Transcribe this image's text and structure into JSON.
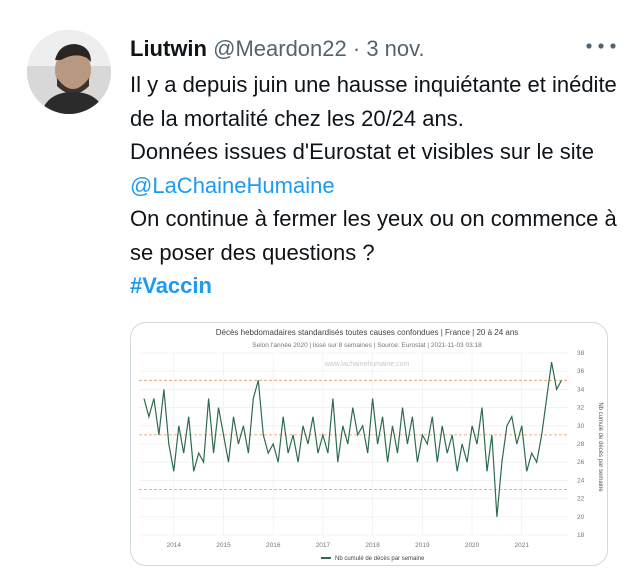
{
  "tweet": {
    "author_name": "Liutwin",
    "author_handle": "@Meardon22",
    "separator": " · ",
    "date": "3 nov.",
    "line1": "Il y a depuis juin une hausse inquiétante et inédite de la mortalité chez les 20/24 ans.",
    "line2_prefix": "Données issues d'Eurostat et visibles sur le site ",
    "mention": "@LaChaineHumaine",
    "line3": "On continue à fermer les yeux ou on commence à se poser des questions ?",
    "hashtag": "#Vaccin",
    "more_icon": "more-dots-icon",
    "colors": {
      "link": "#1d9bf0",
      "text": "#0f1419",
      "secondary": "#536471"
    }
  },
  "chart_data": {
    "type": "line",
    "title": "Décès hebdomadaires standardisés toutes causes confondues | France | 20 à 24 ans",
    "subtitle": "Selon l'année 2020 | lissé sur 8 semaines | Source: Eurostat | 2021-11-03 03:18",
    "watermark": "www.lachainehumaine.com",
    "ylabel": "Nb cumulé de décès par semaine",
    "legend": "Nb cumulé de décès par semaine",
    "legend_position": "bottom",
    "y_ticks": [
      "18",
      "20",
      "22",
      "24",
      "26",
      "28",
      "30",
      "32",
      "34",
      "36",
      "38"
    ],
    "x_ticks": [
      "2014",
      "2015",
      "2016",
      "2017",
      "2018",
      "2019",
      "2020",
      "2021"
    ],
    "ylim": [
      18,
      38
    ],
    "grid": true,
    "reference_lines": [
      35,
      29,
      23
    ],
    "series": [
      {
        "color": "#2e6b4f",
        "x": [
          2013.4,
          2013.5,
          2013.6,
          2013.7,
          2013.8,
          2013.9,
          2014.0,
          2014.1,
          2014.2,
          2014.3,
          2014.4,
          2014.5,
          2014.6,
          2014.7,
          2014.8,
          2014.9,
          2015.0,
          2015.1,
          2015.2,
          2015.3,
          2015.4,
          2015.5,
          2015.6,
          2015.7,
          2015.8,
          2015.9,
          2016.0,
          2016.1,
          2016.2,
          2016.3,
          2016.4,
          2016.5,
          2016.6,
          2016.7,
          2016.8,
          2016.9,
          2017.0,
          2017.1,
          2017.2,
          2017.3,
          2017.4,
          2017.5,
          2017.6,
          2017.7,
          2017.8,
          2017.9,
          2018.0,
          2018.1,
          2018.2,
          2018.3,
          2018.4,
          2018.5,
          2018.6,
          2018.7,
          2018.8,
          2018.9,
          2019.0,
          2019.1,
          2019.2,
          2019.3,
          2019.4,
          2019.5,
          2019.6,
          2019.7,
          2019.8,
          2019.9,
          2020.0,
          2020.1,
          2020.2,
          2020.3,
          2020.4,
          2020.5,
          2020.6,
          2020.7,
          2020.8,
          2020.9,
          2021.0,
          2021.1,
          2021.2,
          2021.3,
          2021.4,
          2021.5,
          2021.6,
          2021.7,
          2021.8
        ],
        "values": [
          33,
          31,
          33,
          29,
          34,
          28,
          25,
          30,
          27,
          31,
          25,
          27,
          26,
          33,
          27,
          32,
          29,
          26,
          31,
          28,
          30,
          27,
          33,
          35,
          29,
          27,
          28,
          26,
          31,
          27,
          29,
          26,
          30,
          28,
          31,
          27,
          29,
          27,
          33,
          26,
          30,
          28,
          32,
          29,
          30,
          27,
          33,
          28,
          31,
          26,
          30,
          27,
          32,
          28,
          31,
          26,
          29,
          28,
          31,
          26,
          30,
          27,
          29,
          25,
          28,
          26,
          30,
          28,
          32,
          25,
          29,
          20,
          26,
          30,
          31,
          28,
          30,
          25,
          27,
          26,
          29,
          33,
          37,
          34,
          35
        ]
      }
    ]
  }
}
